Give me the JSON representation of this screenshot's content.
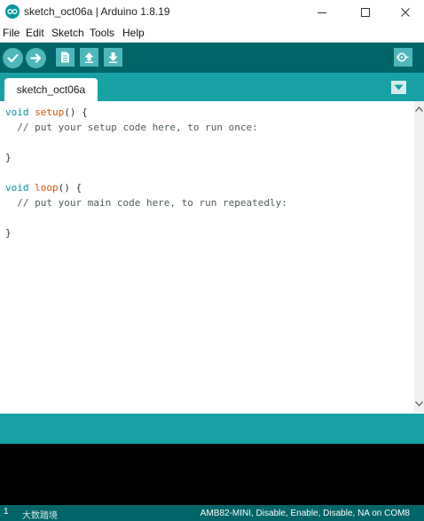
{
  "window": {
    "title": "sketch_oct06a | Arduino 1.8.19",
    "icon": "arduino-logo-icon"
  },
  "menu": {
    "items": [
      "File",
      "Edit",
      "Sketch",
      "Tools",
      "Help"
    ]
  },
  "toolbar": {
    "buttons": [
      "verify-icon",
      "upload-icon",
      "new-icon",
      "open-icon",
      "save-icon",
      "serial-monitor-icon"
    ]
  },
  "tabs": {
    "active": "sketch_oct06a"
  },
  "editor": {
    "lines": [
      "void setup() {",
      "  // put your setup code here, to run once:",
      "",
      "}",
      "",
      "void loop() {",
      "  // put your main code here, to run repeatedly:",
      "",
      "}"
    ]
  },
  "status": {
    "line_number": "1",
    "ime_text": "大数踏境",
    "board": "AMB82-MINI, Disable, Enable, Disable, NA on COM8"
  },
  "colors": {
    "toolbar": "#006468",
    "tabrow": "#17a1a5",
    "button": "#4db7bb",
    "keyword": "#00979c",
    "function": "#d35400"
  }
}
